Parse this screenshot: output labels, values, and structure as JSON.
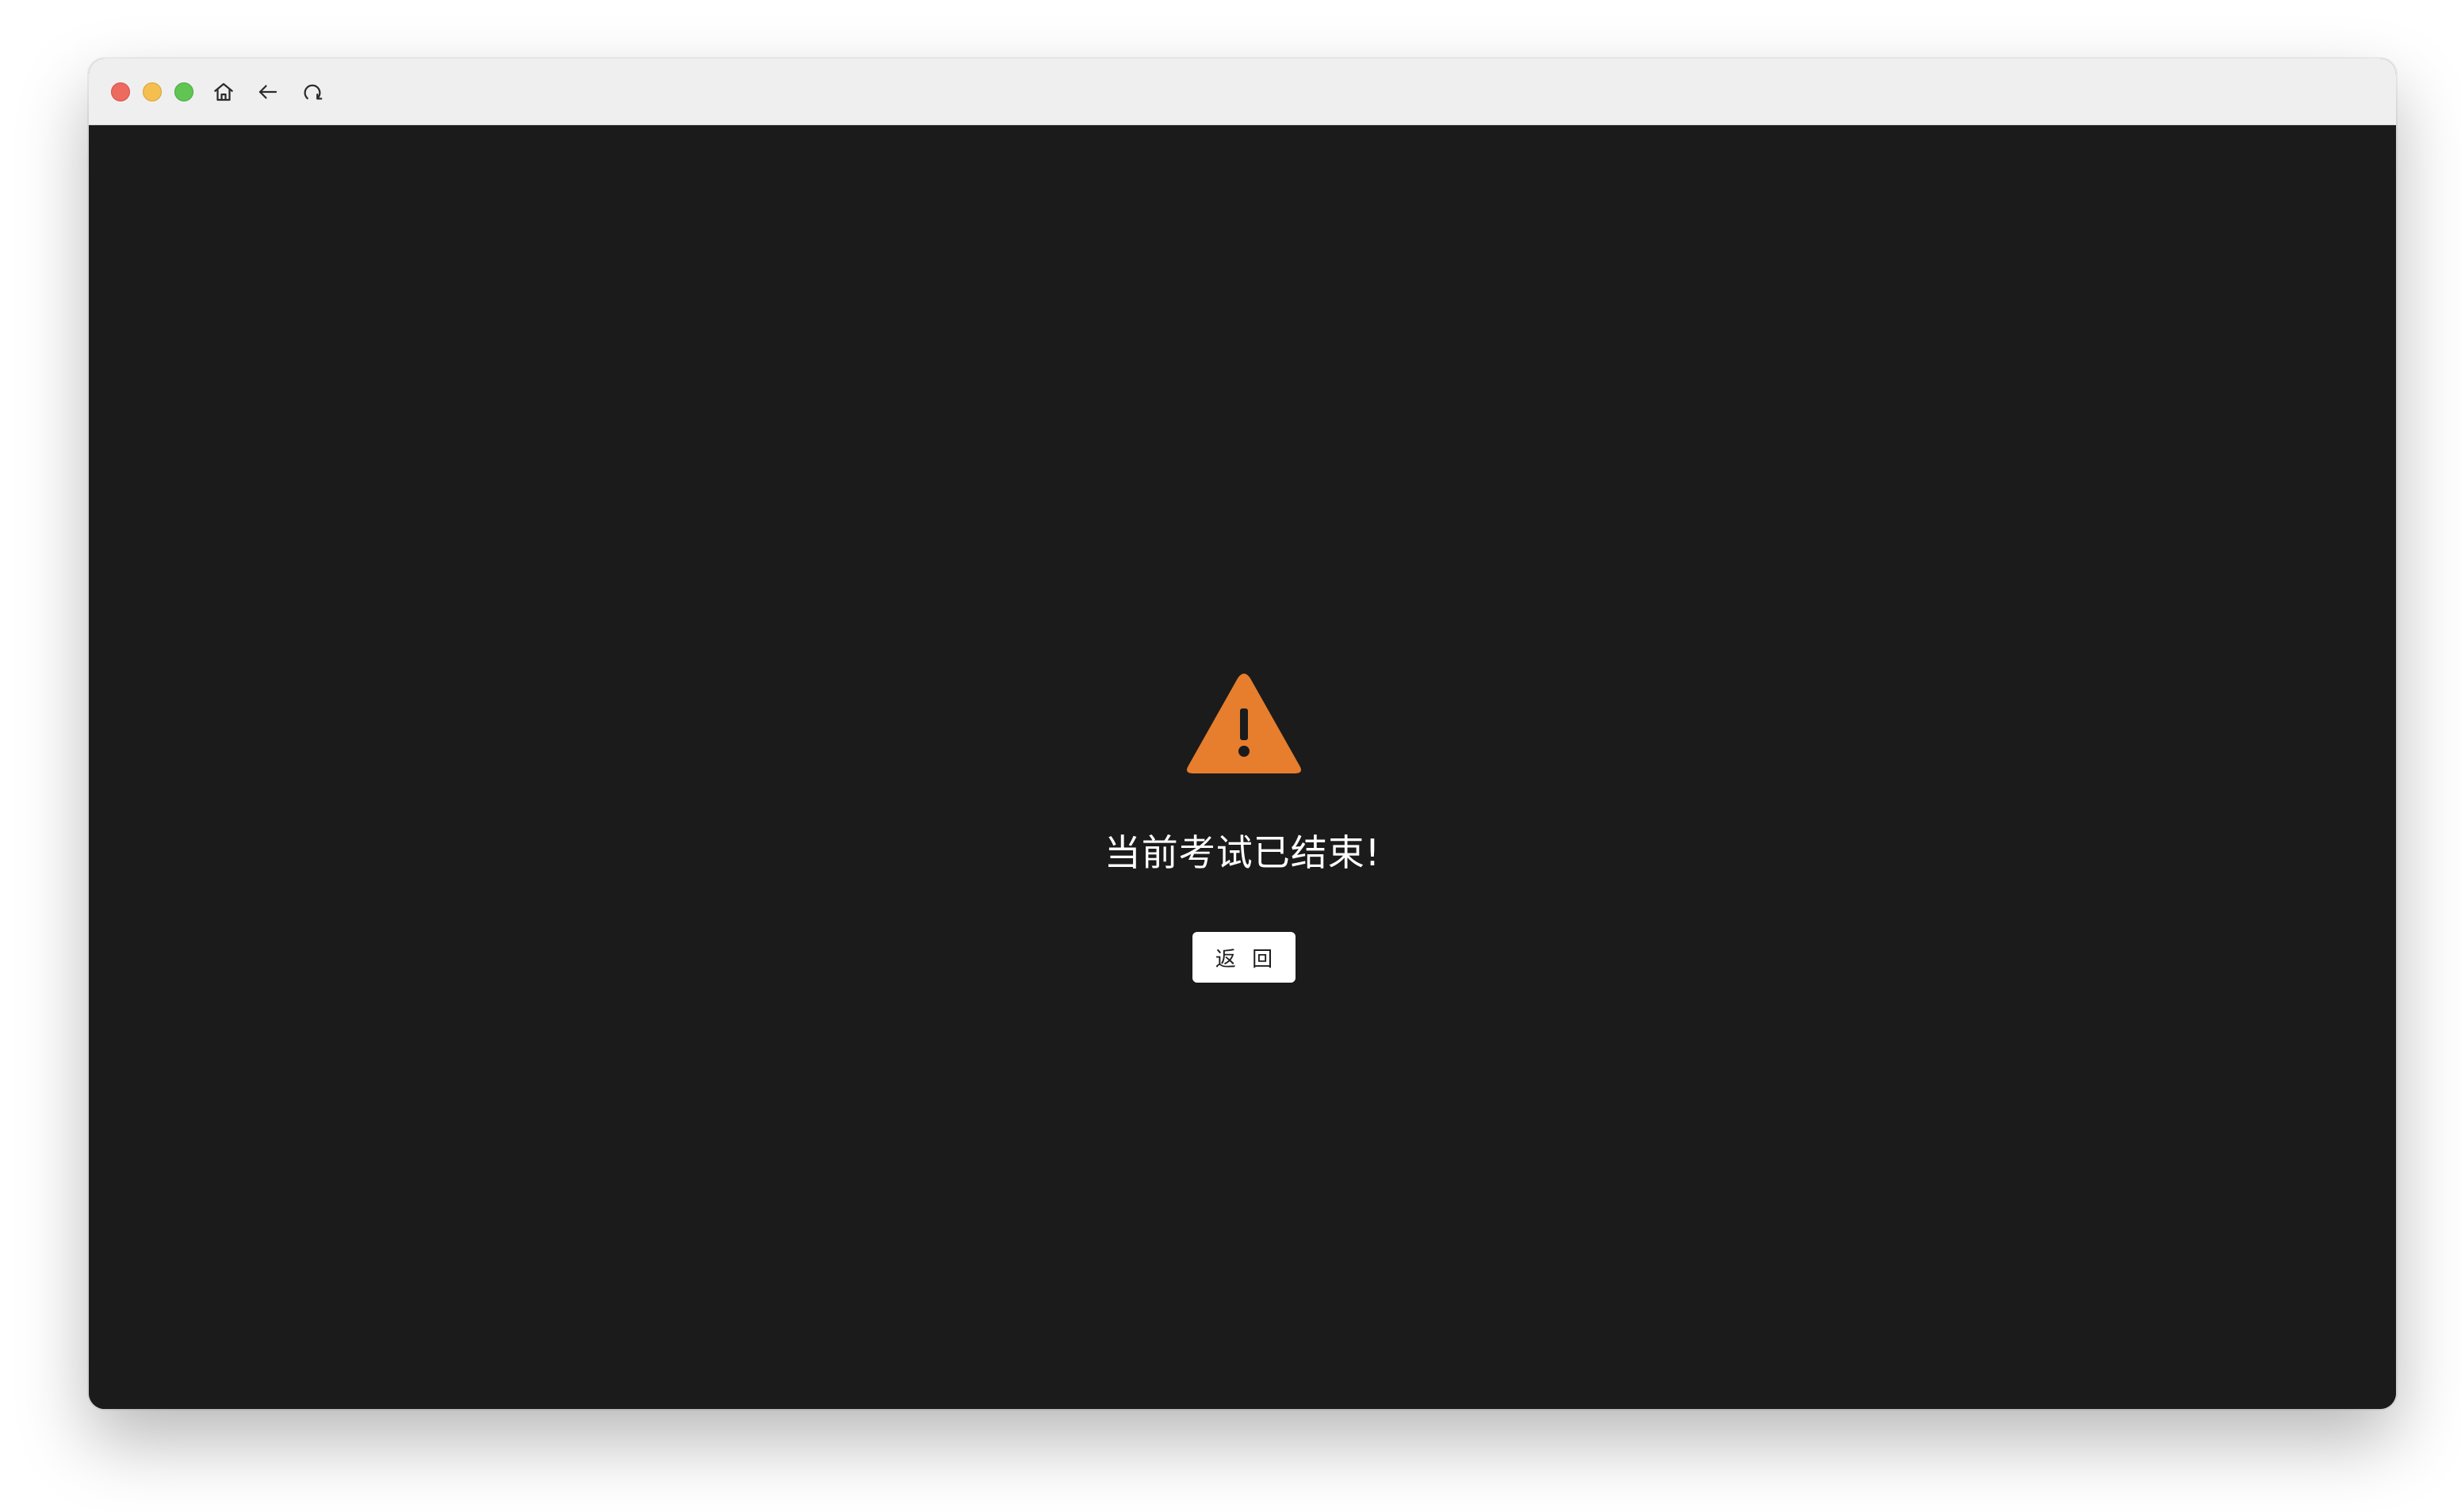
{
  "window": {
    "traffic_lights": {
      "close_color": "#ed6a5e",
      "minimize_color": "#f5bf4f",
      "maximize_color": "#61c554"
    },
    "toolbar": {
      "icons": [
        "home-icon",
        "back-arrow-icon",
        "reload-icon"
      ]
    }
  },
  "main": {
    "icon": "warning-icon",
    "icon_color": "#e67e2e",
    "message": "当前考试已结束!",
    "back_button_label": "返 回"
  },
  "colors": {
    "content_background": "#1b1b1b",
    "titlebar_background": "#efefef"
  }
}
